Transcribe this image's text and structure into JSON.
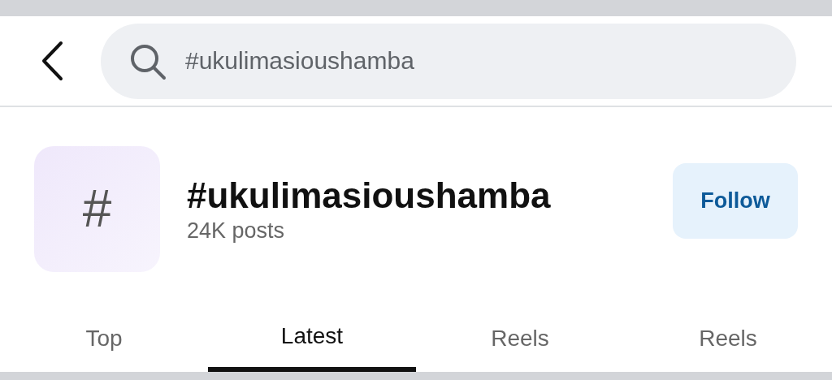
{
  "search": {
    "value": "#ukulimasioushamba"
  },
  "hashtag": {
    "symbol": "#",
    "title": "#ukulimasioushamba",
    "posts": "24K posts",
    "follow_button": "Follow"
  },
  "tabs": [
    {
      "label": "Top",
      "selected": false
    },
    {
      "label": "Latest",
      "selected": true
    },
    {
      "label": "Reels",
      "selected": false
    },
    {
      "label": "Reels",
      "selected": false
    }
  ]
}
